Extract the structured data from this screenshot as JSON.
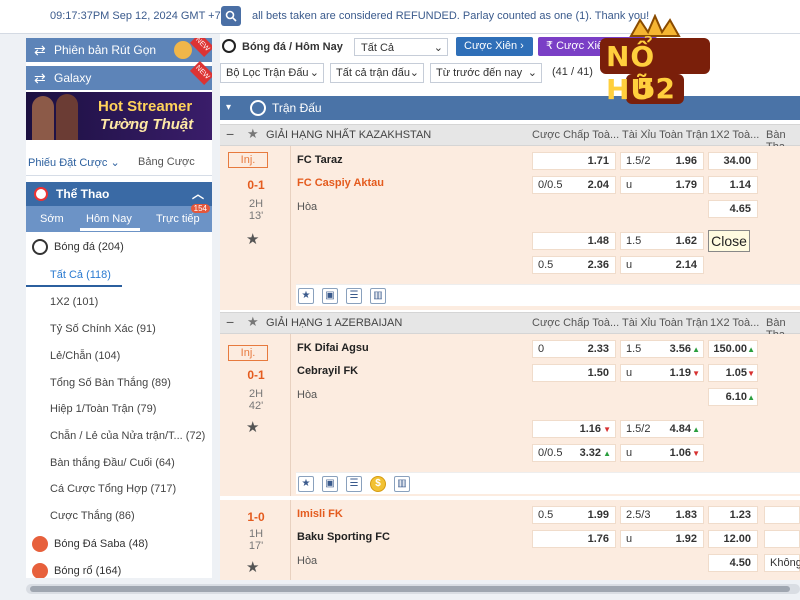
{
  "topbar": {
    "clock": "09:17:37PM Sep 12, 2024 GMT +7",
    "marquee": "all bets taken are considered REFUNDED. Parlay counted as one (1). Thank you!"
  },
  "sidebar": {
    "btn_withdraw": "Phiên bản Rút Gọn",
    "btn_galaxy": "Galaxy",
    "new_tag": "NEW",
    "streamer_line1": "Hot Streamer",
    "streamer_line2": "Tường Thuật",
    "tab_slip": "Phiếu Đặt Cược",
    "tab_table": "Bảng Cược",
    "sports_header": "Thể Thao",
    "subtab_early": "Sớm",
    "subtab_today": "Hôm Nay",
    "subtab_live": "Trực tiếp",
    "live_badge": "154",
    "soccer_label": "Bóng đá",
    "soccer_count": "(204)",
    "items": [
      {
        "label": "Tất Cả",
        "count": "(118)"
      },
      {
        "label": "1X2",
        "count": "(101)"
      },
      {
        "label": "Tỷ Số Chính Xác",
        "count": "(91)"
      },
      {
        "label": "Lẻ/Chẵn",
        "count": "(104)"
      },
      {
        "label": "Tổng Số Bàn Thắng",
        "count": "(89)"
      },
      {
        "label": "Hiệp 1/Toàn Trận",
        "count": "(79)"
      },
      {
        "label": "Chẵn / Lẻ của Nửa trận/T...",
        "count": "(72)"
      },
      {
        "label": "Bàn thắng Đầu/ Cuối",
        "count": "(64)"
      },
      {
        "label": "Cá Cược Tổng Hợp",
        "count": "(717)"
      },
      {
        "label": "Cược Thắng",
        "count": "(86)"
      }
    ],
    "saba_label": "Bóng Đá Saba",
    "saba_count": "(48)",
    "basket_label": "Bóng rổ",
    "basket_count": "(164)"
  },
  "filters": {
    "sport_title": "Bóng đá / Hôm Nay",
    "select_all": "Tất Cả",
    "btn_parlay": "Cược Xiên",
    "btn_lucky_parlay": "Cược Xiên May Mắn",
    "filter_match": "Bộ Lọc Trận Đấu",
    "filter_all_matches": "Tất cả trận đấu",
    "filter_sort": "Từ trước đến nay",
    "count": "(41 / 41)"
  },
  "section_title": "Trận Đấu",
  "columns": {
    "handicap": "Cược Chấp Toà...",
    "ou": "Tài Xỉu Toàn Trận",
    "x12": "1X2 Toà...",
    "other": "Bàn Tha"
  },
  "leagues": [
    {
      "name": "GIẢI HẠNG NHẤT KAZAKHSTAN"
    },
    {
      "name": "GIẢI HẠNG 1 AZERBAIJAN"
    }
  ],
  "matches": [
    {
      "inj": "Inj.",
      "score": "0-1",
      "half": "2H",
      "minute": "13'",
      "home": "FC Taraz",
      "away": "FC Caspiy Aktau",
      "draw": "Hòa",
      "r1_hcap_l": "",
      "r1_hcap_v": "1.71",
      "r1_ou_l": "1.5/2",
      "r1_ou_v": "1.96",
      "r1_x12": "34.00",
      "r2_hcap_l": "0/0.5",
      "r2_hcap_v": "2.04",
      "r2_ou_l": "u",
      "r2_ou_v": "1.79",
      "r2_x12": "1.14",
      "r3_x12": "4.65",
      "r4_hcap_l": "",
      "r4_hcap_v": "1.48",
      "r4_ou_l": "1.5",
      "r4_ou_v": "1.62",
      "r5_hcap_l": "0.5",
      "r5_hcap_v": "2.36",
      "r5_ou_l": "u",
      "r5_ou_v": "2.14"
    },
    {
      "inj": "Inj.",
      "score": "0-1",
      "half": "2H",
      "minute": "42'",
      "home": "FK Difai Agsu",
      "away": "Cebrayil FK",
      "draw": "Hòa",
      "r1_hcap_l": "0",
      "r1_hcap_v": "2.33",
      "r1_ou_l": "1.5",
      "r1_ou_v": "3.56",
      "r1_x12": "150.00",
      "r2_hcap_l": "",
      "r2_hcap_v": "1.50",
      "r2_ou_l": "u",
      "r2_ou_v": "1.19",
      "r2_x12": "1.05",
      "r3_x12": "6.10",
      "r4_hcap_l": "",
      "r4_hcap_v": "1.16",
      "r4_ou_l": "1.5/2",
      "r4_ou_v": "4.84",
      "r5_hcap_l": "0/0.5",
      "r5_hcap_v": "3.32",
      "r5_ou_l": "u",
      "r5_ou_v": "1.06"
    },
    {
      "score": "1-0",
      "half": "1H",
      "minute": "17'",
      "home": "Imisli FK",
      "away": "Baku Sporting FC",
      "draw": "Hòa",
      "r1_hcap_l": "0.5",
      "r1_hcap_v": "1.99",
      "r1_ou_l": "2.5/3",
      "r1_ou_v": "1.83",
      "r1_x12": "1.23",
      "r2_hcap_l": "",
      "r2_hcap_v": "1.76",
      "r2_ou_l": "u",
      "r2_ou_v": "1.92",
      "r2_x12": "12.00",
      "r3_x12": "4.50",
      "r3_other": "Không"
    }
  ],
  "close_label": "Close",
  "logo_text_1": "NỔ HŨ",
  "logo_text_2": "52",
  "colors": {
    "brand_blue": "#3a6aa5",
    "accent_orange": "#e45b1e",
    "match_bg": "#fcece0"
  }
}
